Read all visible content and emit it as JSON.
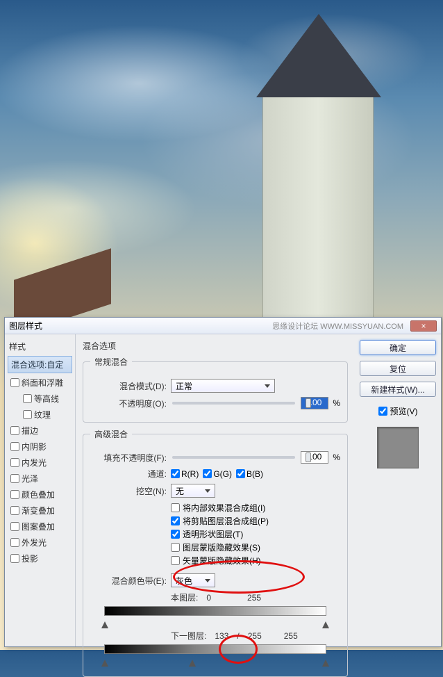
{
  "watermark": "思缘设计论坛 WWW.MISSYUAN.COM",
  "dialog": {
    "title": "图层样式",
    "close": "×"
  },
  "sidebar": {
    "header": "样式",
    "selected": "混合选项:自定",
    "items": [
      {
        "label": "斜面和浮雕",
        "checked": false,
        "sub": false
      },
      {
        "label": "等高线",
        "checked": false,
        "sub": true
      },
      {
        "label": "纹理",
        "checked": false,
        "sub": true
      },
      {
        "label": "描边",
        "checked": false,
        "sub": false
      },
      {
        "label": "内阴影",
        "checked": false,
        "sub": false
      },
      {
        "label": "内发光",
        "checked": false,
        "sub": false
      },
      {
        "label": "光泽",
        "checked": false,
        "sub": false
      },
      {
        "label": "颜色叠加",
        "checked": false,
        "sub": false
      },
      {
        "label": "渐变叠加",
        "checked": false,
        "sub": false
      },
      {
        "label": "图案叠加",
        "checked": false,
        "sub": false
      },
      {
        "label": "外发光",
        "checked": false,
        "sub": false
      },
      {
        "label": "投影",
        "checked": false,
        "sub": false
      }
    ]
  },
  "main": {
    "blend_options_title": "混合选项",
    "general": {
      "legend": "常规混合",
      "mode_label": "混合模式(D):",
      "mode_value": "正常",
      "opacity_label": "不透明度(O):",
      "opacity_value": "100",
      "percent": "%"
    },
    "advanced": {
      "legend": "高级混合",
      "fill_label": "填充不透明度(F):",
      "fill_value": "100",
      "percent": "%",
      "channel_label": "通道:",
      "channels": [
        {
          "label": "R(R)",
          "checked": true
        },
        {
          "label": "G(G)",
          "checked": true
        },
        {
          "label": "B(B)",
          "checked": true
        }
      ],
      "knockout_label": "挖空(N):",
      "knockout_value": "无",
      "checks": [
        {
          "label": "将内部效果混合成组(I)",
          "checked": false
        },
        {
          "label": "将剪贴图层混合成组(P)",
          "checked": true
        },
        {
          "label": "透明形状图层(T)",
          "checked": true
        },
        {
          "label": "图层蒙版隐藏效果(S)",
          "checked": false
        },
        {
          "label": "矢量蒙版隐藏效果(H)",
          "checked": false
        }
      ],
      "blendif_label": "混合颜色带(E):",
      "blendif_value": "灰色",
      "this_layer_label": "本图层:",
      "this_vals": [
        "0",
        "255"
      ],
      "under_layer_label": "下一图层:",
      "under_vals": [
        "133",
        "/",
        "255",
        "255"
      ]
    }
  },
  "right": {
    "ok": "确定",
    "cancel": "复位",
    "newstyle": "新建样式(W)...",
    "preview_label": "预览(V)"
  }
}
